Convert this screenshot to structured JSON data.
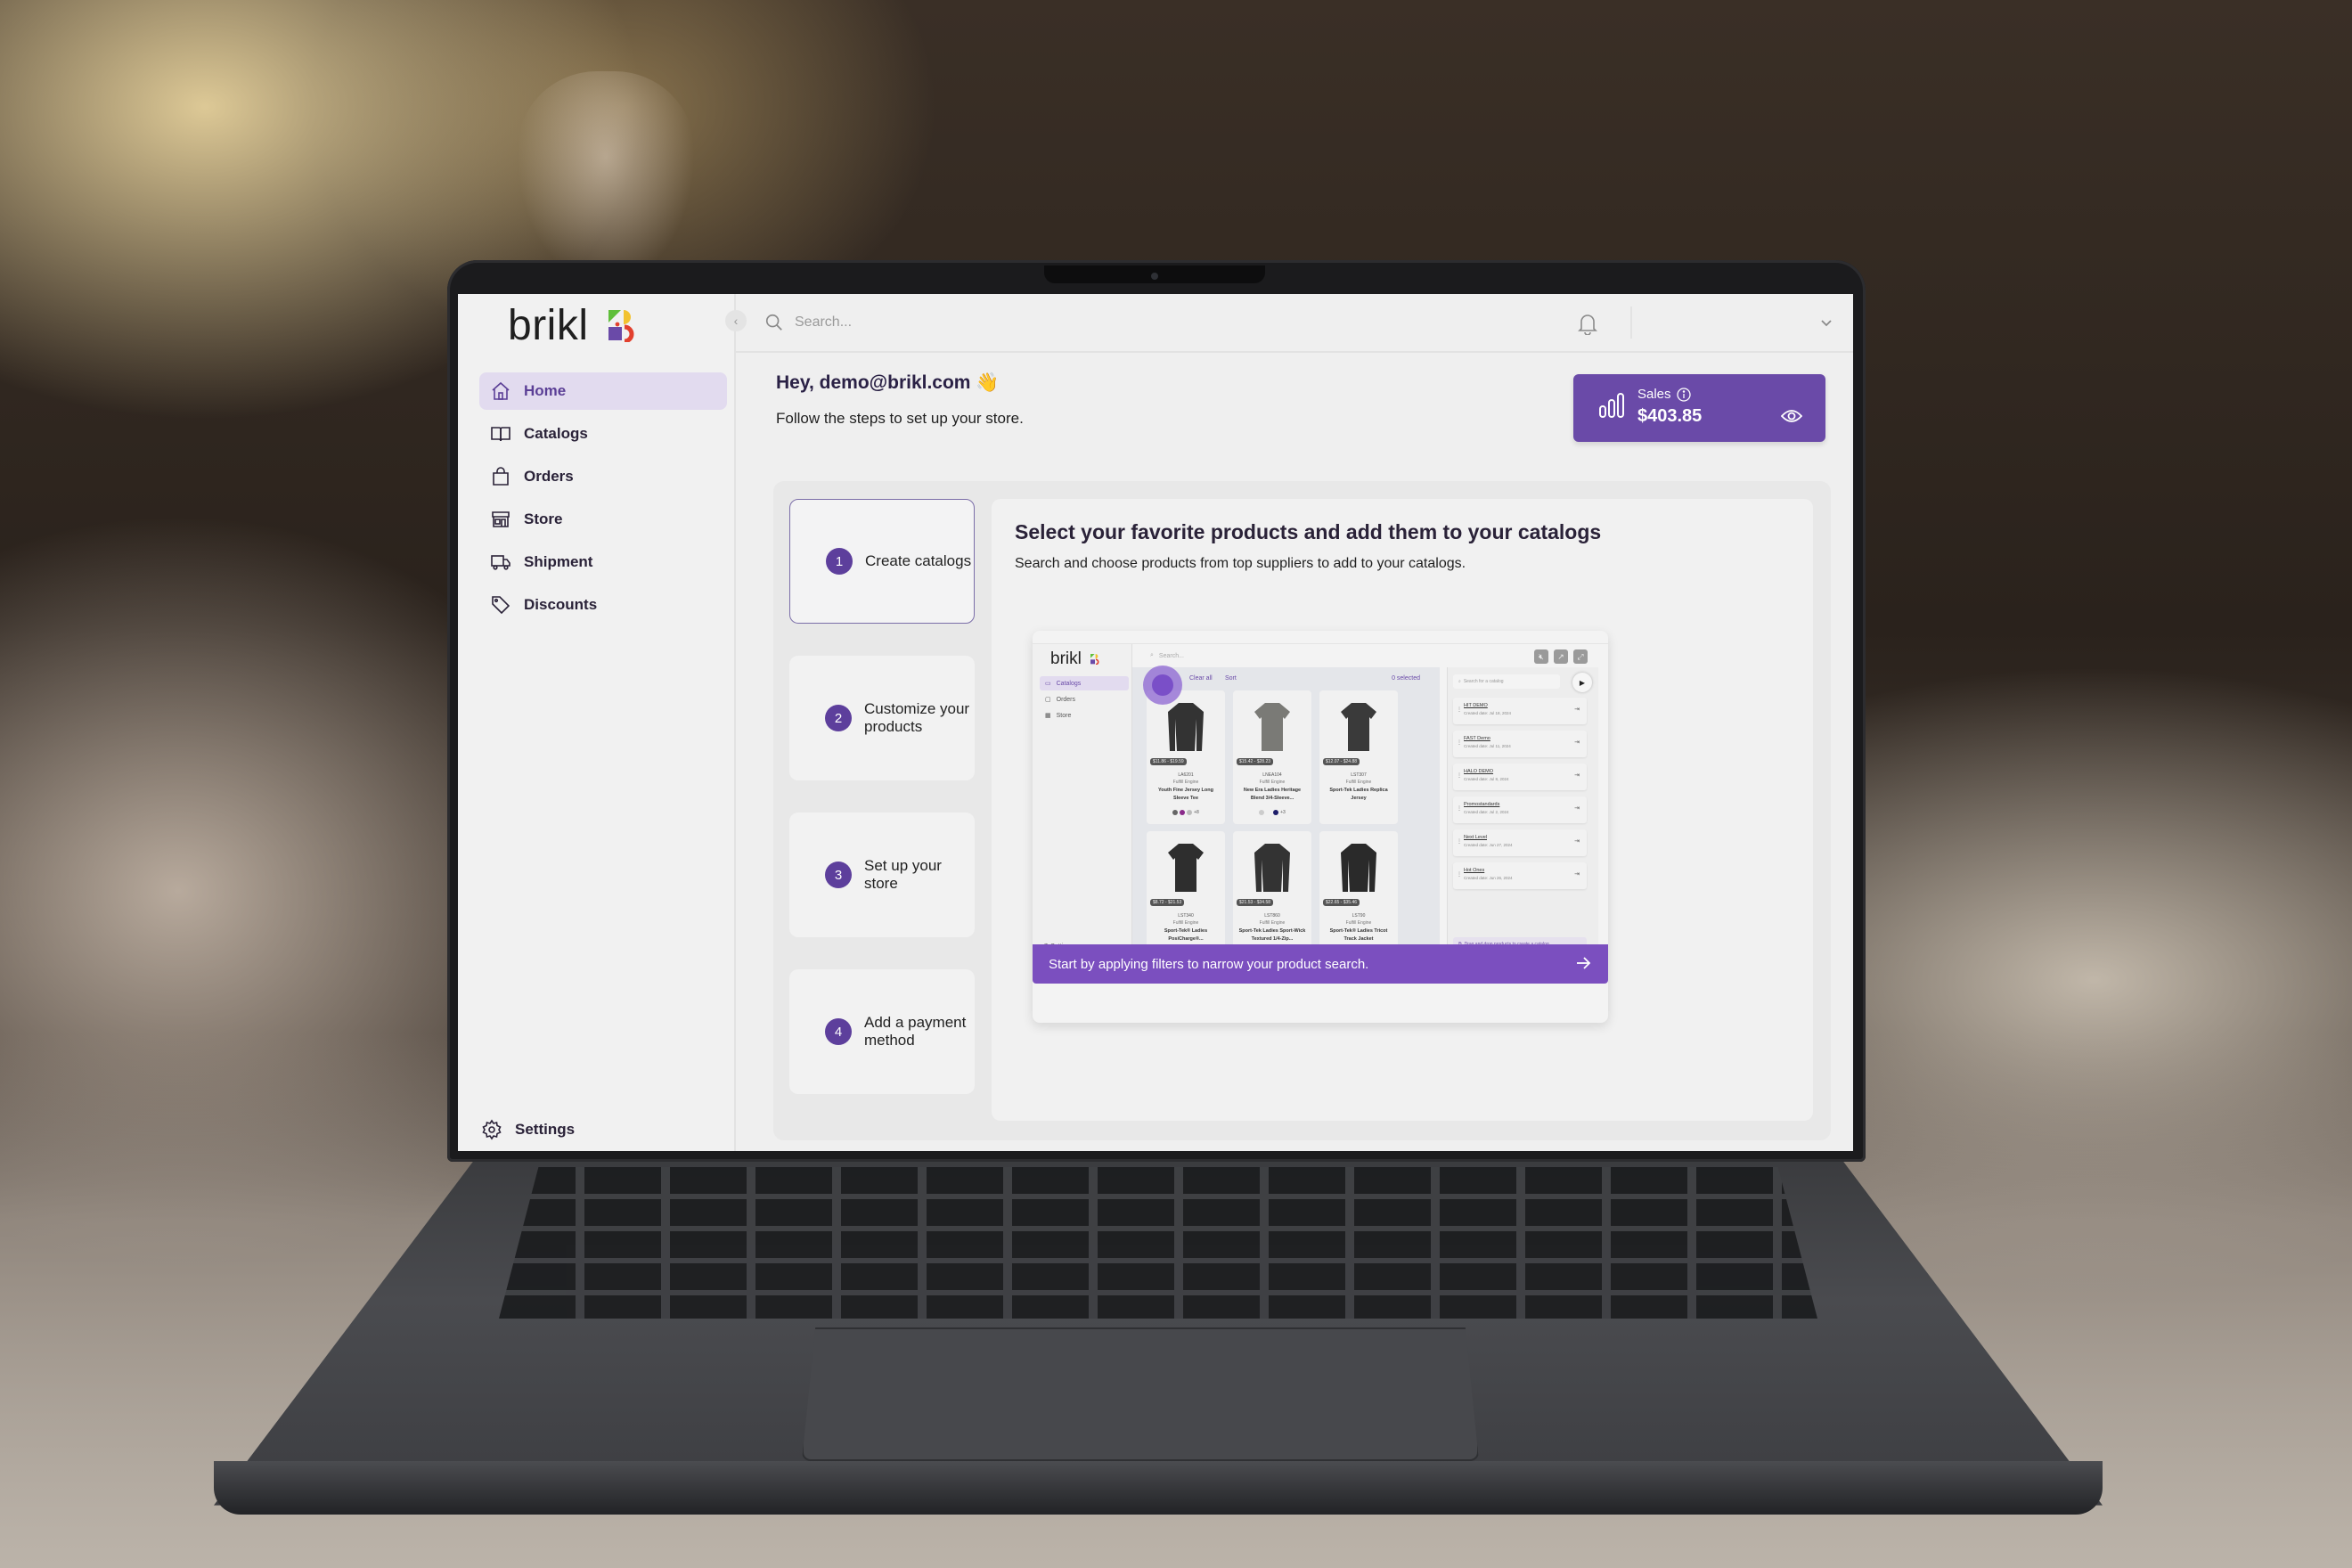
{
  "app": {
    "brand": "brikl",
    "brand_colors": {
      "accent": "#6a4aa8",
      "accent_light": "#e2dbef",
      "green": "#5fbf3a",
      "yellow": "#f2c230",
      "red": "#e2402e"
    }
  },
  "sidebar": {
    "items": [
      {
        "label": "Home",
        "icon": "home-icon",
        "active": true
      },
      {
        "label": "Catalogs",
        "icon": "book-icon",
        "active": false
      },
      {
        "label": "Orders",
        "icon": "shopping-bag-icon",
        "active": false
      },
      {
        "label": "Store",
        "icon": "storefront-icon",
        "active": false
      },
      {
        "label": "Shipment",
        "icon": "truck-icon",
        "active": false
      },
      {
        "label": "Discounts",
        "icon": "tag-icon",
        "active": false
      }
    ],
    "settings_label": "Settings"
  },
  "topbar": {
    "search_placeholder": "Search..."
  },
  "greeting": {
    "title": "Hey, demo@brikl.com 👋",
    "subtitle": "Follow the steps to set up your store."
  },
  "sales": {
    "label": "Sales",
    "value": "$403.85"
  },
  "steps": [
    {
      "number": "1",
      "label": "Create catalogs",
      "active": true
    },
    {
      "number": "2",
      "label": "Customize your products",
      "active": false
    },
    {
      "number": "3",
      "label": "Set up your store",
      "active": false
    },
    {
      "number": "4",
      "label": "Add a payment method",
      "active": false
    }
  ],
  "detail": {
    "title": "Select your favorite products and add them to your catalogs",
    "description": "Search and choose products from top suppliers to add to your catalogs."
  },
  "preview": {
    "brand": "brikl",
    "nav": [
      "Catalogs",
      "Orders",
      "Store"
    ],
    "settings": "Settings",
    "search_placeholder": "Search...",
    "toolbar": {
      "clear": "Clear all",
      "sort": "Sort",
      "selected": "0 selected"
    },
    "products": [
      {
        "price": "$11.86 - $19.59",
        "sku": "LA6201",
        "supplier": "Fulfill Engine",
        "name": "Youth Fine Jersey Long Sleeve Tee",
        "more": "+8",
        "color": "#333333"
      },
      {
        "price": "$15.42 - $28.23",
        "sku": "LNEA104",
        "supplier": "Fulfill Engine",
        "name": "New Era Ladies Heritage Blend 3/4-Sleeve...",
        "more": "+3",
        "color": "#7a7a76"
      },
      {
        "price": "$12.07 - $24.88",
        "sku": "LST307",
        "supplier": "Fulfill Engine",
        "name": "Sport-Tek Ladies Replica Jersey",
        "more": "",
        "color": "#3a3a3a"
      },
      {
        "price": "$8.72 - $21.53",
        "sku": "LST340",
        "supplier": "Fulfill Engine",
        "name": "Sport-Tek® Ladies PosiCharge®...",
        "more": "",
        "color": "#2e2e2e"
      },
      {
        "price": "$21.53 - $34.58",
        "sku": "LST860",
        "supplier": "Fulfill Engine",
        "name": "Sport-Tek Ladies Sport-Wick Textured 1/4-Zip...",
        "more": "",
        "color": "#333333"
      },
      {
        "price": "$22.65 - $35.46",
        "sku": "LST90",
        "supplier": "Fulfill Engine",
        "name": "Sport-Tek® Ladies Tricot Track Jacket",
        "more": "",
        "color": "#2a2a2a"
      }
    ],
    "catalog_search_placeholder": "Search for a catalog",
    "catalogs": [
      {
        "name": "HIT DEMO",
        "date": "Created date: Jul 18, 2024"
      },
      {
        "name": "FAST Demo",
        "date": "Created date: Jul 11, 2024"
      },
      {
        "name": "HALO DEMO",
        "date": "Created date: Jul 8, 2024"
      },
      {
        "name": "Promostandards",
        "date": "Created date: Jul 2, 2024"
      },
      {
        "name": "Next Level",
        "date": "Created date: Jun 27, 2024"
      },
      {
        "name": "Hot Ones",
        "date": "Created date: Jun 26, 2024"
      }
    ],
    "drop_hint": "Drag and drop products to create a catalog",
    "banner": "Start by applying filters to narrow your product search."
  }
}
